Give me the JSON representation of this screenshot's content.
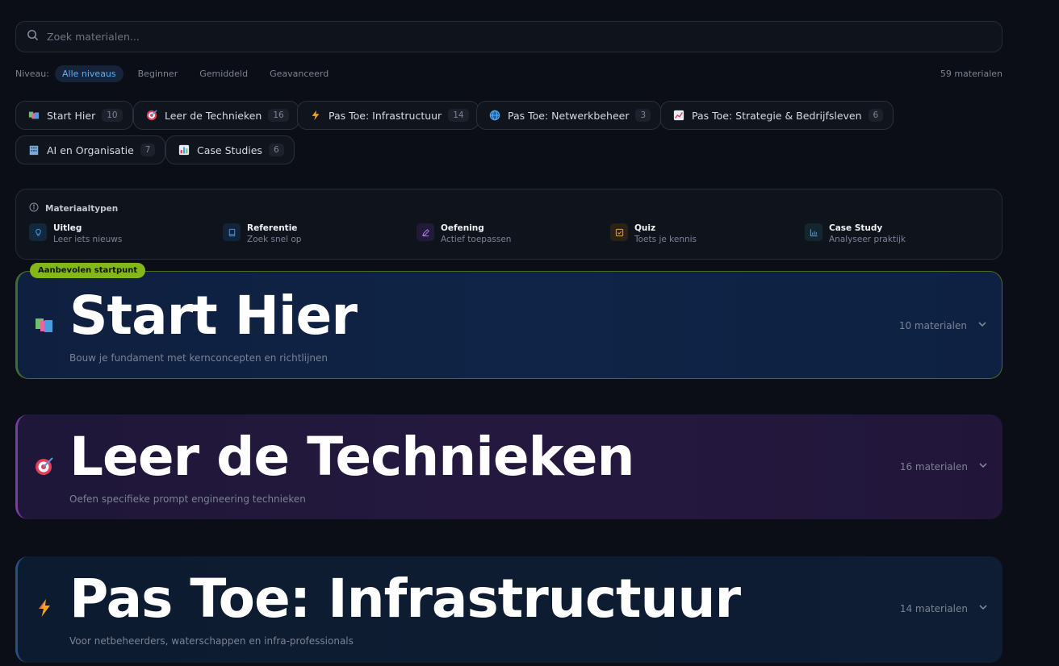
{
  "search": {
    "placeholder": "Zoek materialen..."
  },
  "levels": {
    "label": "Niveau:",
    "options": [
      "Alle niveaus",
      "Beginner",
      "Gemiddeld",
      "Geavanceerd"
    ],
    "total": "59 materialen"
  },
  "categories": [
    {
      "label": "Start Hier",
      "count": "10"
    },
    {
      "label": "Leer de Technieken",
      "count": "16"
    },
    {
      "label": "Pas Toe: Infrastructuur",
      "count": "14"
    },
    {
      "label": "Pas Toe: Netwerkbeheer",
      "count": "3"
    },
    {
      "label": "Pas Toe: Strategie & Bedrijfsleven",
      "count": "6"
    },
    {
      "label": "AI en Organisatie",
      "count": "7"
    },
    {
      "label": "Case Studies",
      "count": "6"
    }
  ],
  "types": {
    "title": "Materiaaltypen",
    "items": [
      {
        "name": "Uitleg",
        "desc": "Leer iets nieuws",
        "color": "#3b9be0"
      },
      {
        "name": "Referentie",
        "desc": "Zoek snel op",
        "color": "#4a8fdc"
      },
      {
        "name": "Oefening",
        "desc": "Actief toepassen",
        "color": "#a07be0"
      },
      {
        "name": "Quiz",
        "desc": "Toets je kennis",
        "color": "#e0a23a"
      },
      {
        "name": "Case Study",
        "desc": "Analyseer praktijk",
        "color": "#5aa0c8"
      }
    ]
  },
  "recommended": "Aanbevolen startpunt",
  "sections": [
    {
      "title": "Start Hier",
      "subtitle": "Bouw je fundament met kernconcepten en richtlijnen",
      "count": "10 materialen"
    },
    {
      "title": "Leer de Technieken",
      "subtitle": "Oefen specifieke prompt engineering technieken",
      "count": "16 materialen"
    },
    {
      "title": "Pas Toe: Infrastructuur",
      "subtitle": "Voor netbeheerders, waterschappen en infra-professionals",
      "count": "14 materialen"
    }
  ]
}
